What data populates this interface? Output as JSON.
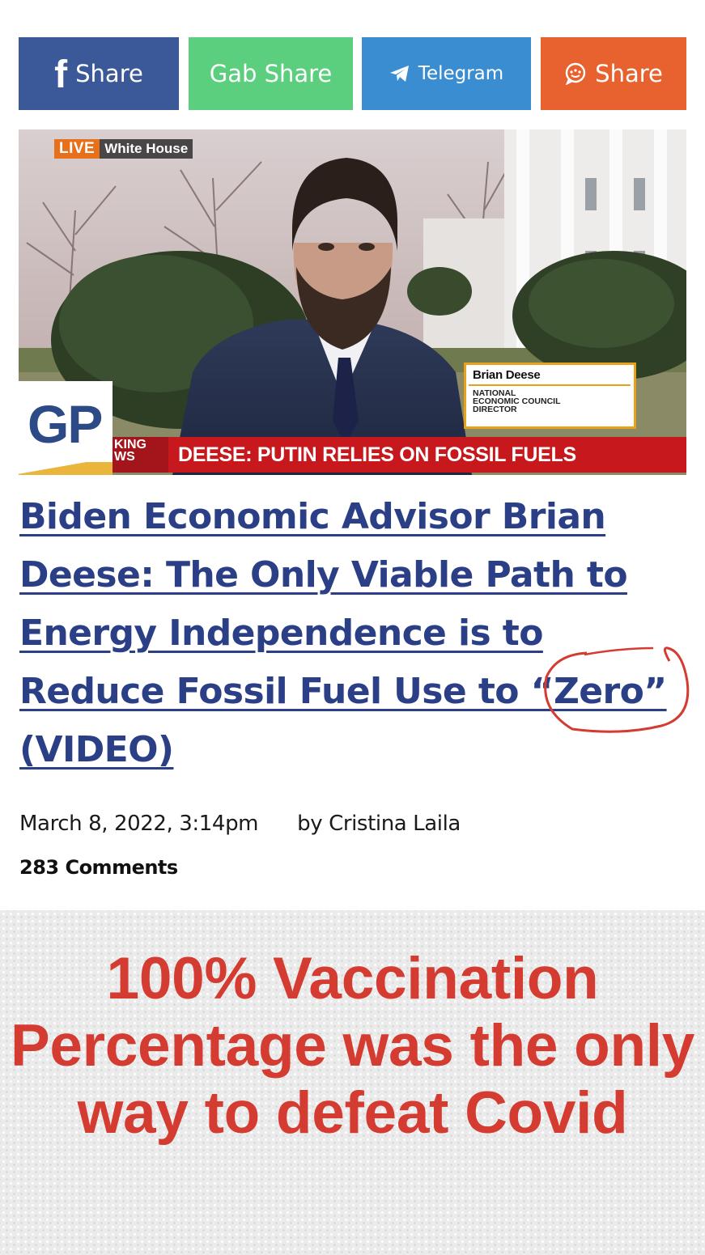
{
  "share_bar": {
    "facebook": {
      "label": "Share",
      "color": "#3b5998",
      "icon": "facebook-icon"
    },
    "gab": {
      "label": "Gab Share",
      "color": "#5ccf7f"
    },
    "telegram": {
      "label": "Telegram",
      "color": "#3a8dd1",
      "icon": "telegram-icon"
    },
    "parler": {
      "label": "Share",
      "color": "#e8622f",
      "icon": "chat-bubble-icon"
    }
  },
  "hero": {
    "live_badge": "LIVE",
    "location": "White House",
    "lower_third": {
      "name": "Brian Deese",
      "title": "NATIONAL\nECONOMIC COUNCIL\nDIRECTOR"
    },
    "ticker_tag": "KING\nWS",
    "ticker_headline": "DEESE: PUTIN RELIES ON FOSSIL FUELS",
    "logo": "GP",
    "colors": {
      "ticker": "#c7191d",
      "live": "#e8701a",
      "logo": "#2c4a86"
    }
  },
  "article": {
    "headline": "Biden Economic Advisor Brian Deese: The Only Viable Path to Energy Independence is to Reduce Fossil Fuel Use to “Zero” (VIDEO)",
    "headline_color": "#2b3f86",
    "date": "March 8, 2022, 3:14pm",
    "author": "by Cristina Laila",
    "comments": "283 Comments"
  },
  "meme": {
    "text": "100% Vaccination Percentage was the only way to defeat Covid",
    "color": "#d43b31"
  }
}
